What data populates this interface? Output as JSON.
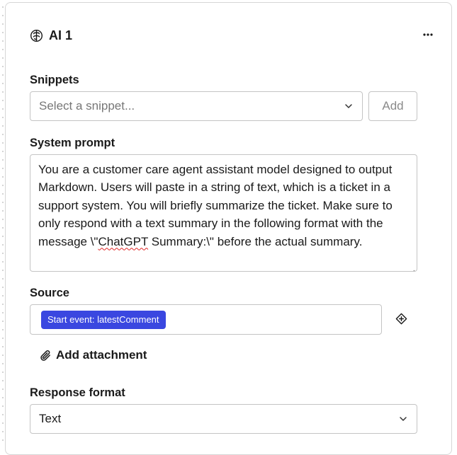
{
  "node": {
    "icon": "brain-icon",
    "title": "AI 1",
    "more_icon": "more-horizontal-icon"
  },
  "snippets": {
    "label": "Snippets",
    "placeholder": "Select a snippet...",
    "add_label": "Add"
  },
  "system_prompt": {
    "label": "System prompt",
    "text_before": "You are a customer care agent assistant model designed to output Markdown. Users will paste in a string of text, which is a ticket in a support system. You will briefly summarize the ticket. Make sure to only respond with a text summary in the following format with the message \\\"",
    "misspelled": "ChatGPT",
    "text_after": " Summary:\\\" before the actual summary."
  },
  "source": {
    "label": "Source",
    "tag": "Start event: latestComment",
    "add_icon": "plus-diamond-icon"
  },
  "attachment": {
    "icon": "paperclip-icon",
    "label": "Add attachment"
  },
  "response_format": {
    "label": "Response format",
    "value": "Text"
  },
  "colors": {
    "accent": "#3a47e0",
    "border": "#c4c4c4",
    "spellcheck": "#e02424"
  }
}
